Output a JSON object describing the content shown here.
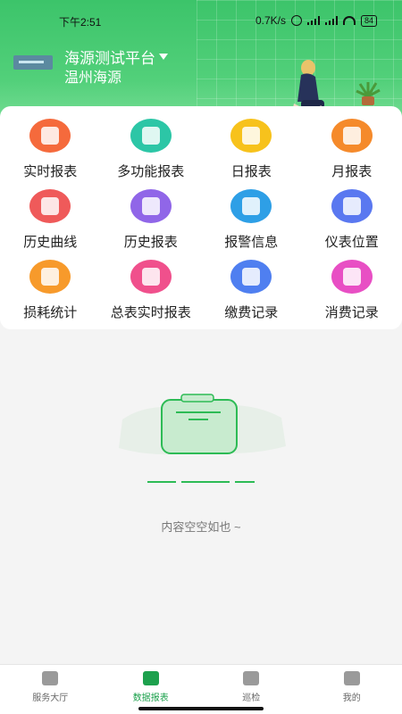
{
  "status_bar": {
    "time": "下午2:51",
    "net_speed": "0.7K/s",
    "battery": "84"
  },
  "header": {
    "platform_name": "海源测试平台",
    "company_name": "温州海源"
  },
  "menu": {
    "items": [
      {
        "label": "实时报表",
        "icon": "pie-chart-icon",
        "color": "#f56a3c"
      },
      {
        "label": "多功能报表",
        "icon": "layers-icon",
        "color": "#2cc6a6"
      },
      {
        "label": "日报表",
        "icon": "calendar-day-icon",
        "color": "#f7c21c"
      },
      {
        "label": "月报表",
        "icon": "calendar-month-icon",
        "color": "#f58a2b"
      },
      {
        "label": "历史曲线",
        "icon": "curve-icon",
        "color": "#ef5a5a"
      },
      {
        "label": "历史报表",
        "icon": "history-report-icon",
        "color": "#9066e8"
      },
      {
        "label": "报警信息",
        "icon": "alarm-light-icon",
        "color": "#2e9fe6"
      },
      {
        "label": "仪表位置",
        "icon": "location-pin-icon",
        "color": "#5a78f0"
      },
      {
        "label": "损耗统计",
        "icon": "bar-stats-icon",
        "color": "#f79a2b"
      },
      {
        "label": "总表实时报表",
        "icon": "printer-icon",
        "color": "#f0508c"
      },
      {
        "label": "缴费记录",
        "icon": "payment-record-icon",
        "color": "#4f7ff0"
      },
      {
        "label": "消费记录",
        "icon": "wallet-icon",
        "color": "#e84fc4"
      }
    ]
  },
  "empty_state": {
    "text": "内容空空如也 ~"
  },
  "tabbar": {
    "tabs": [
      {
        "label": "服务大厅",
        "icon": "chat-icon",
        "active": false
      },
      {
        "label": "数据报表",
        "icon": "router-icon",
        "active": true
      },
      {
        "label": "巡检",
        "icon": "inspect-icon",
        "active": false
      },
      {
        "label": "我的",
        "icon": "user-icon",
        "active": false
      }
    ]
  },
  "colors": {
    "brand_green": "#3cc46a",
    "active_tab": "#1da14d"
  }
}
